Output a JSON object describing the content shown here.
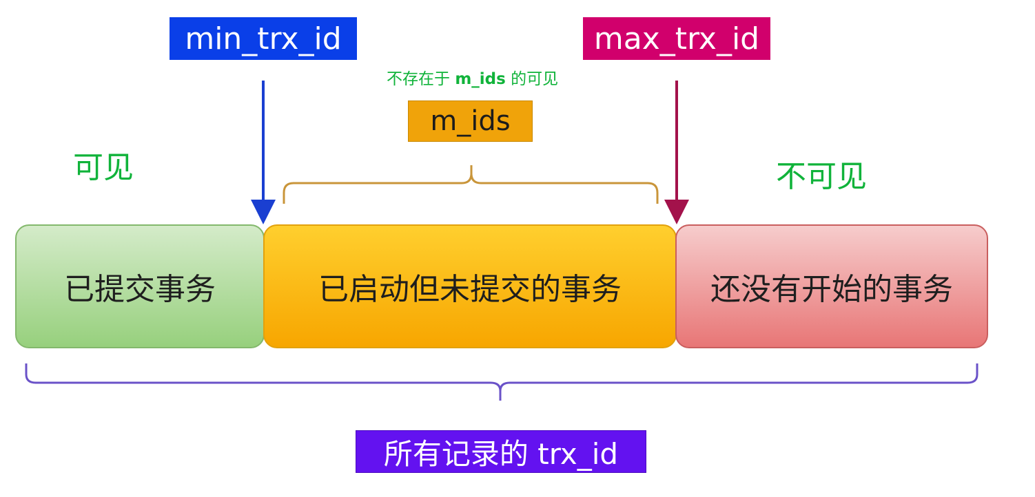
{
  "labels": {
    "min_trx_id": "min_trx_id",
    "max_trx_id": "max_trx_id",
    "m_ids": "m_ids",
    "all_trx_id": "所有记录的 trx_id"
  },
  "annotations": {
    "visible": "可见",
    "invisible": "不可见",
    "mids_note_prefix": "不存在于 ",
    "mids_note_bold": "m_ids",
    "mids_note_suffix": " 的可见"
  },
  "segments": {
    "committed": "已提交事务",
    "active": "已启动但未提交的事务",
    "future": "还没有开始的事务"
  },
  "colors": {
    "min_box": "#0a3fe8",
    "max_box": "#d1006c",
    "m_ids_box": "#f0a30a",
    "all_box": "#6312f0",
    "green_text": "#10b33a",
    "committed_segment": "#97d07d",
    "active_segment": "#f7a600",
    "future_segment": "#e87676",
    "min_arrow": "#1a3fd1",
    "max_arrow": "#a3124b",
    "m_ids_brace": "#c9953a",
    "all_brace": "#6a52c8"
  }
}
